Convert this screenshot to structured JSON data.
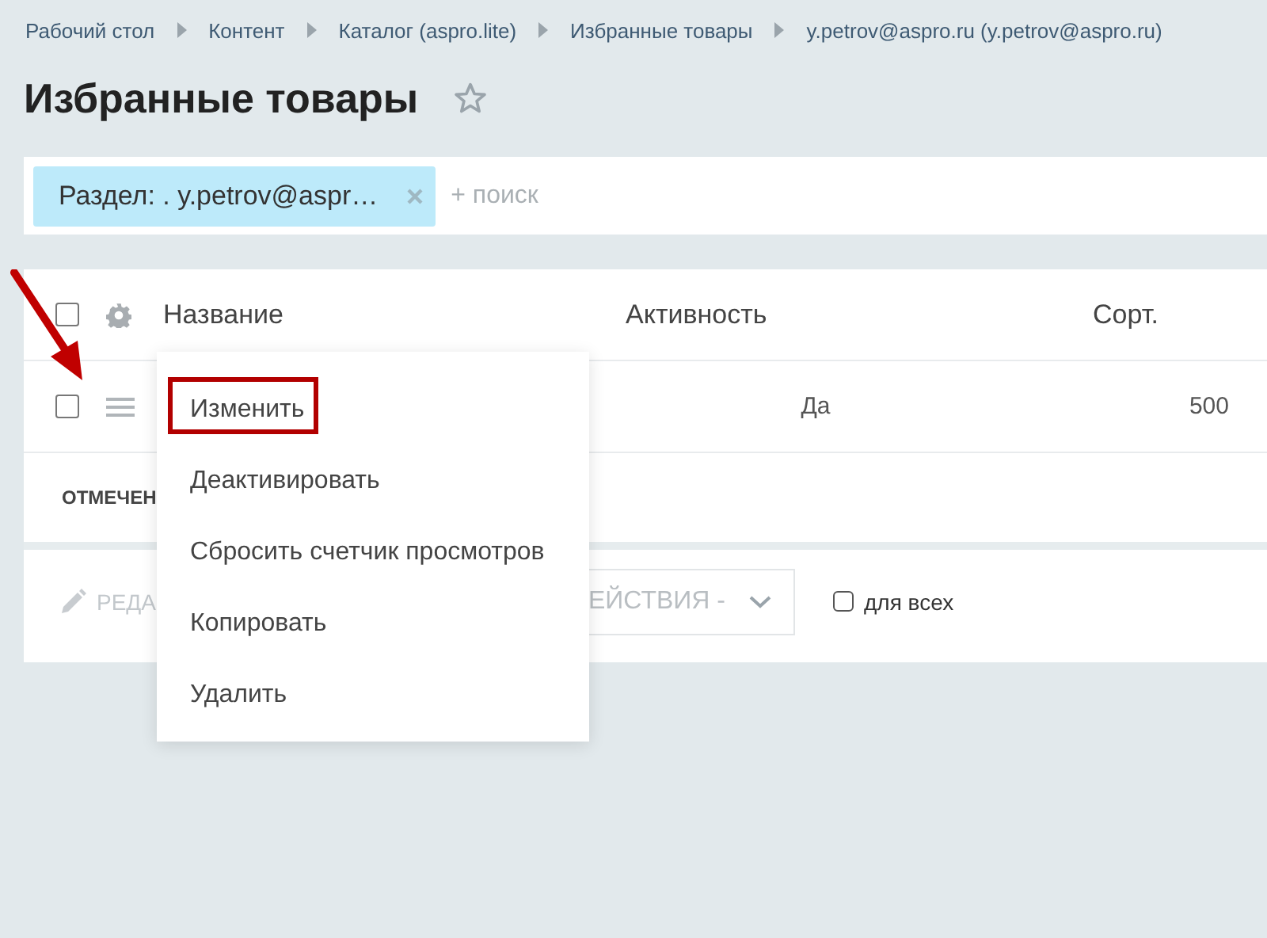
{
  "breadcrumbs": [
    "Рабочий стол",
    "Контент",
    "Каталог (aspro.lite)",
    "Избранные товары",
    "y.petrov@aspro.ru (y.petrov@aspro.ru)"
  ],
  "title": "Избранные товары",
  "favorite": false,
  "filter": {
    "tag": "Раздел: . y.petrov@aspr…",
    "placeholder": "+ поиск"
  },
  "table": {
    "all_checked": false,
    "columns": [
      "Название",
      "Активность",
      "Сорт."
    ],
    "rows": [
      {
        "checked": false,
        "activity": "Да",
        "sort": "500"
      }
    ],
    "selected_label": "ОТМЕЧЕН"
  },
  "footer": {
    "edit_label": "РЕДА",
    "actions_label": "ЕЙСТВИЯ -",
    "for_all": {
      "label": "для всех",
      "checked": false
    }
  },
  "context_menu": [
    {
      "label": "Изменить",
      "selected": true
    },
    {
      "label": "Деактивировать",
      "selected": false
    },
    {
      "label": "Сбросить счетчик просмотров",
      "selected": false
    },
    {
      "label": "Копировать",
      "selected": false
    },
    {
      "label": "Удалить",
      "selected": false
    }
  ]
}
